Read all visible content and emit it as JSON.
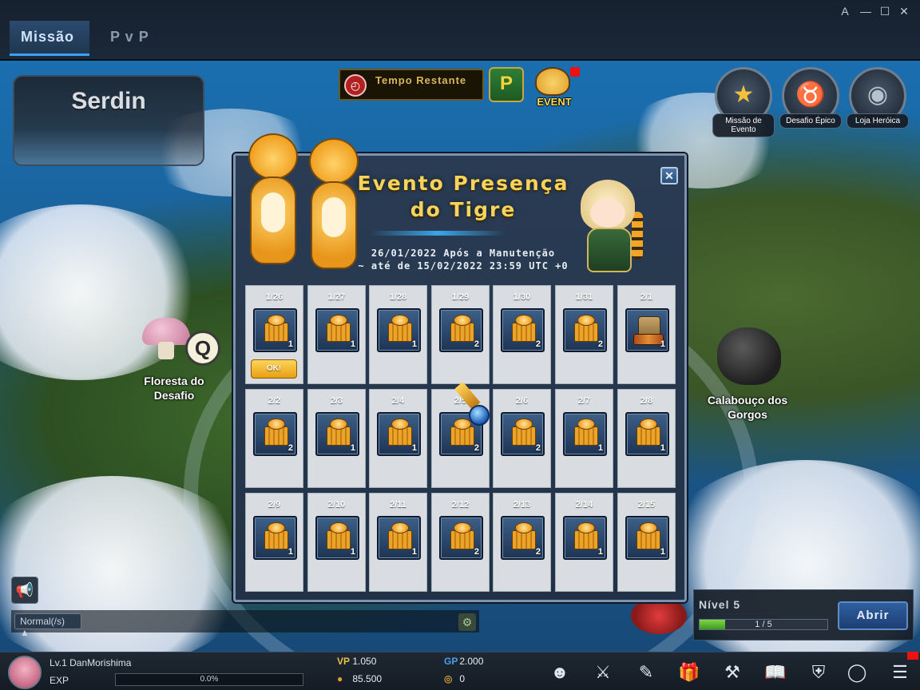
{
  "window": {
    "buttons": [
      "A",
      "—",
      "☐",
      "✕"
    ]
  },
  "tabs": [
    {
      "label": "Missão",
      "active": true
    },
    {
      "label": "P v P",
      "active": false
    }
  ],
  "location": {
    "name": "Serdin"
  },
  "top_center": {
    "timer_label": "Tempo Restante",
    "p_button": "P",
    "event_button": "EVENT"
  },
  "right_buttons": [
    {
      "label": "Missão de Evento",
      "icon": "star-icon"
    },
    {
      "label": "Desafio Épico",
      "icon": "bull-skull-icon"
    },
    {
      "label": "Loja Heróica",
      "icon": "shop-icon"
    }
  ],
  "map": {
    "forest_label": "Floresta do Desafio",
    "q_badge": "Q",
    "dungeon_label": "Calabouço dos Gorgos"
  },
  "popup": {
    "title_line1": "Evento Presença",
    "title_line2": "do Tigre",
    "date_line1": "26/01/2022 Após a Manutenção",
    "date_line2": "~ até de 15/02/2022 23:59 UTC +0",
    "close_label": "✕",
    "ok_label": "OK!",
    "days": [
      {
        "date": "1/26",
        "qty": "1",
        "item": "tiger-box-icon",
        "claimed": true
      },
      {
        "date": "1/27",
        "qty": "1",
        "item": "tiger-box-icon"
      },
      {
        "date": "1/28",
        "qty": "1",
        "item": "tiger-box-icon"
      },
      {
        "date": "1/29",
        "qty": "2",
        "item": "tiger-box-icon"
      },
      {
        "date": "1/30",
        "qty": "2",
        "item": "tiger-box-icon"
      },
      {
        "date": "1/31",
        "qty": "2",
        "item": "tiger-box-icon"
      },
      {
        "date": "2/1",
        "qty": "1",
        "item": "special-chest-icon"
      },
      {
        "date": "2/2",
        "qty": "2",
        "item": "tiger-box-icon"
      },
      {
        "date": "2/3",
        "qty": "1",
        "item": "tiger-box-icon"
      },
      {
        "date": "2/4",
        "qty": "1",
        "item": "tiger-box-icon"
      },
      {
        "date": "2/5",
        "qty": "2",
        "item": "tiger-box-icon"
      },
      {
        "date": "2/6",
        "qty": "2",
        "item": "tiger-box-icon"
      },
      {
        "date": "2/7",
        "qty": "1",
        "item": "tiger-box-icon"
      },
      {
        "date": "2/8",
        "qty": "1",
        "item": "tiger-box-icon"
      },
      {
        "date": "2/9",
        "qty": "1",
        "item": "tiger-box-icon"
      },
      {
        "date": "2/10",
        "qty": "1",
        "item": "tiger-box-icon"
      },
      {
        "date": "2/11",
        "qty": "1",
        "item": "tiger-box-icon"
      },
      {
        "date": "2/12",
        "qty": "2",
        "item": "tiger-box-icon"
      },
      {
        "date": "2/13",
        "qty": "2",
        "item": "tiger-box-icon"
      },
      {
        "date": "2/14",
        "qty": "1",
        "item": "tiger-box-icon"
      },
      {
        "date": "2/15",
        "qty": "1",
        "item": "tiger-box-icon"
      }
    ]
  },
  "chat": {
    "mode": "Normal(/s) ▲"
  },
  "level_panel": {
    "level": "Nível 5",
    "progress_text": "1 / 5",
    "progress_fraction": 0.2,
    "open_button": "Abrir"
  },
  "player": {
    "name": "Lv.1 DanMorishima",
    "exp_label": "EXP",
    "exp_value": "0.0%",
    "vp_label": "VP",
    "vp": "1.050",
    "gp_label": "GP",
    "gp": "2.000",
    "gold": "85.500",
    "coins": "0"
  },
  "toolbar_icons": [
    "character-icon",
    "swords-icon",
    "quest-icon",
    "gift-icon",
    "anvil-icon",
    "book-icon",
    "guild-icon",
    "ring-icon",
    "menu-icon"
  ]
}
